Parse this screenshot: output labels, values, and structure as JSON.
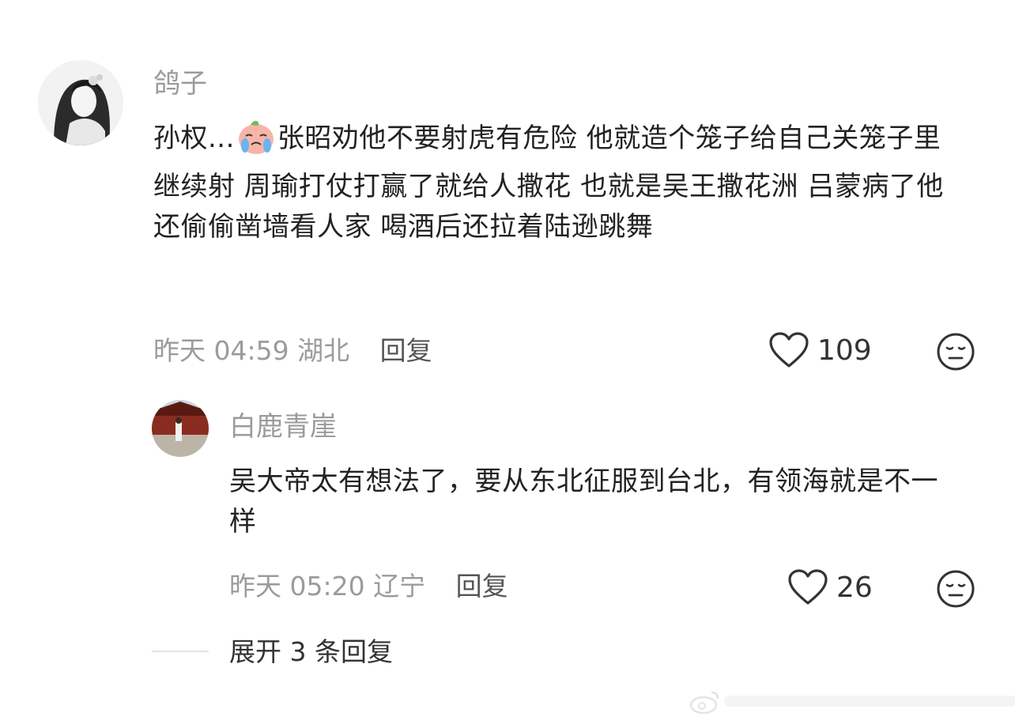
{
  "comments": [
    {
      "username": "鸽子",
      "text_before_emoji": "孙权...",
      "emoji": "crying-face-emoji",
      "text_after_emoji": "张昭劝他不要射虎有危险 他就造个笼子给自己关笼子里继续射 周瑜打仗打赢了就给人撒花 也就是吴王撒花洲 吕蒙病了他还偷偷凿墙看人家 喝酒后还拉着陆逊跳舞",
      "time": "昨天 04:59",
      "location": "湖北",
      "reply_label": "回复",
      "likes": "109"
    }
  ],
  "replies": [
    {
      "username": "白鹿青崖",
      "text": "吴大帝太有想法了，要从东北征服到台北，有领海就是不一样",
      "time": "昨天 05:20",
      "location": "辽宁",
      "reply_label": "回复",
      "likes": "26"
    }
  ],
  "expand_label": "展开 3 条回复",
  "colors": {
    "meta": "#9b9b9b",
    "text": "#222222",
    "divider": "#e3e3e3"
  }
}
